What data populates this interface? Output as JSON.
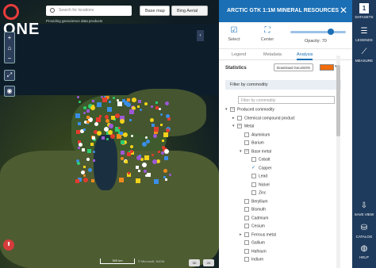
{
  "app": {
    "logo_text": "ONE",
    "tagline": "Providing geoscience data products",
    "search_placeholder": "Search for locations",
    "basemap_label": "Base map",
    "bing_label": "Bing Aerial",
    "scale_text": "300 km",
    "attribution": "© Microsoft, NASA"
  },
  "panel": {
    "title": "ARCTIC GTK 1:1M MINERAL RESOURCES",
    "select_label": "Select",
    "center_label": "Center",
    "opacity_label": "Opacity: 70",
    "opacity_value": 0.7,
    "tabs": [
      "Legend",
      "Metadata",
      "Analysis"
    ],
    "active_tab": "Analysis",
    "statistics_label": "Statistics",
    "download_label": "Download GeoJSON",
    "swatch_color": "#f06c0c",
    "filter_heading": "Filter by commodity",
    "filter_placeholder": "Filter by commodity",
    "tree": [
      {
        "label": "Produced commodity",
        "level": 0,
        "toggle": "▾",
        "check": "minus"
      },
      {
        "label": "Chemical compound product",
        "level": 1,
        "toggle": "▸",
        "check": "empty"
      },
      {
        "label": "Metal",
        "level": 1,
        "toggle": "▾",
        "check": "minus"
      },
      {
        "label": "Aluminium",
        "level": 2,
        "toggle": "",
        "check": "empty"
      },
      {
        "label": "Barium",
        "level": 2,
        "toggle": "",
        "check": "empty"
      },
      {
        "label": "Base metal",
        "level": 2,
        "toggle": "▾",
        "check": "minus"
      },
      {
        "label": "Cobalt",
        "level": 3,
        "toggle": "",
        "check": "empty"
      },
      {
        "label": "Copper",
        "level": 3,
        "toggle": "",
        "check": "checked"
      },
      {
        "label": "Lead",
        "level": 3,
        "toggle": "",
        "check": "empty"
      },
      {
        "label": "Nickel",
        "level": 3,
        "toggle": "",
        "check": "empty"
      },
      {
        "label": "Zinc",
        "level": 3,
        "toggle": "",
        "check": "empty"
      },
      {
        "label": "Beryllium",
        "level": 2,
        "toggle": "",
        "check": "empty"
      },
      {
        "label": "Bismuth",
        "level": 2,
        "toggle": "",
        "check": "empty"
      },
      {
        "label": "Cadmium",
        "level": 2,
        "toggle": "",
        "check": "empty"
      },
      {
        "label": "Cesium",
        "level": 2,
        "toggle": "",
        "check": "empty"
      },
      {
        "label": "Ferrous metal",
        "level": 2,
        "toggle": "▸",
        "check": "empty"
      },
      {
        "label": "Gallium",
        "level": 2,
        "toggle": "",
        "check": "empty"
      },
      {
        "label": "Hafnium",
        "level": 2,
        "toggle": "",
        "check": "empty"
      },
      {
        "label": "Indium",
        "level": 2,
        "toggle": "",
        "check": "empty"
      }
    ]
  },
  "rail": {
    "datasets_count": "1",
    "datasets_label": "DATASETS",
    "legends_label": "LEGENDS",
    "measure_label": "MEASURE",
    "saveview_label": "SAVE VIEW",
    "catalog_label": "CATALOG",
    "help_label": "HELP"
  },
  "colors": {
    "panel_header": "#1a6fb5",
    "rail_bg": "#1e3a5c",
    "accent": "#1a6fb5"
  }
}
